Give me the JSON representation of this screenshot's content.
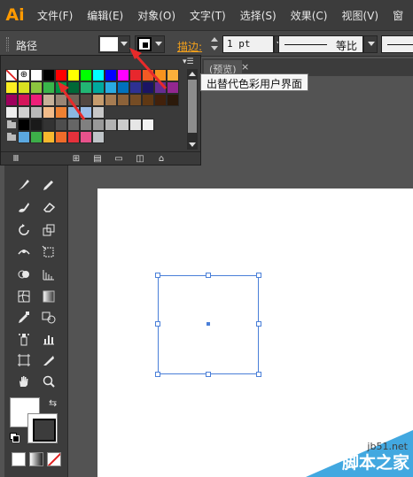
{
  "app": {
    "logo": "Ai"
  },
  "menu": [
    "文件(F)",
    "编辑(E)",
    "对象(O)",
    "文字(T)",
    "选择(S)",
    "效果(C)",
    "视图(V)",
    "窗"
  ],
  "control_bar": {
    "selection_label": "路径",
    "stroke_label": "描边:",
    "stroke_weight": "1 pt",
    "profile_label": "等比"
  },
  "doc_tab": {
    "label": "(预览)",
    "close": "×"
  },
  "tooltip": "出替代色彩用户界面",
  "swatch_colors": [
    [
      "none",
      "reg",
      "#ffffff",
      "#000000",
      "#ff0000",
      "#ffff00",
      "#00ff00",
      "#00ffff",
      "#0000ff",
      "#ff00ff",
      "#e8272d",
      "#f15a24",
      "#f7931e",
      "#fbb03b"
    ],
    [
      "#fcee21",
      "#d9e021",
      "#8cc63f",
      "#39b54a",
      "#009245",
      "#006837",
      "#22b573",
      "#00a99d",
      "#29abe2",
      "#0071bc",
      "#2e3192",
      "#1b1464",
      "#662d91",
      "#93278f"
    ],
    [
      "#9e005d",
      "#d4145a",
      "#ed1e79",
      "#c7b299",
      "#998675",
      "#736357",
      "#534741",
      "#c69c6d",
      "#a67c52",
      "#8c6239",
      "#754c24",
      "#603813",
      "#42210b",
      "#2c1a0b"
    ],
    [
      "#eeeeee",
      "#cfcfcf",
      "#b9b9b9",
      "#f2bc8a",
      "#ee8133",
      "#8ab7e0",
      "#9bbce7",
      "#c7c7c7"
    ],
    [
      "folder",
      "#000000",
      "#1a1a1a",
      "#333333",
      "#4d4d4d",
      "#666666",
      "#808080",
      "#999999",
      "#b3b3b3",
      "#cccccc",
      "#e6e6e6",
      "#f2f2f2"
    ],
    [
      "folder",
      "#5ba8e0",
      "#3dae49",
      "#f7b82e",
      "#ef6c2a",
      "#e4313b",
      "#e7528b",
      "#bfc4c8"
    ]
  ],
  "swatch_footer_icons": [
    "swatch-libraries-icon",
    "show-kinds-icon",
    "swatch-options-icon",
    "new-color-group-icon",
    "new-swatch-icon",
    "delete-swatch-icon"
  ],
  "toolbox": {
    "tools": [
      [
        "paintbrush-icon",
        "pencil-icon"
      ],
      [
        "blob-brush-icon",
        "eraser-icon"
      ],
      [
        "rotate-icon",
        "scale-icon"
      ],
      [
        "width-icon",
        "free-transform-icon"
      ],
      [
        "shape-builder-icon",
        "perspective-grid-icon"
      ],
      [
        "mesh-icon",
        "gradient-icon"
      ],
      [
        "eyedropper-icon",
        "blend-icon"
      ],
      [
        "symbol-sprayer-icon",
        "column-graph-icon"
      ],
      [
        "artboard-icon",
        "slice-icon"
      ],
      [
        "hand-icon",
        "zoom-icon"
      ]
    ]
  },
  "watermark": {
    "site": "jb51.net",
    "name": "脚本之家"
  }
}
